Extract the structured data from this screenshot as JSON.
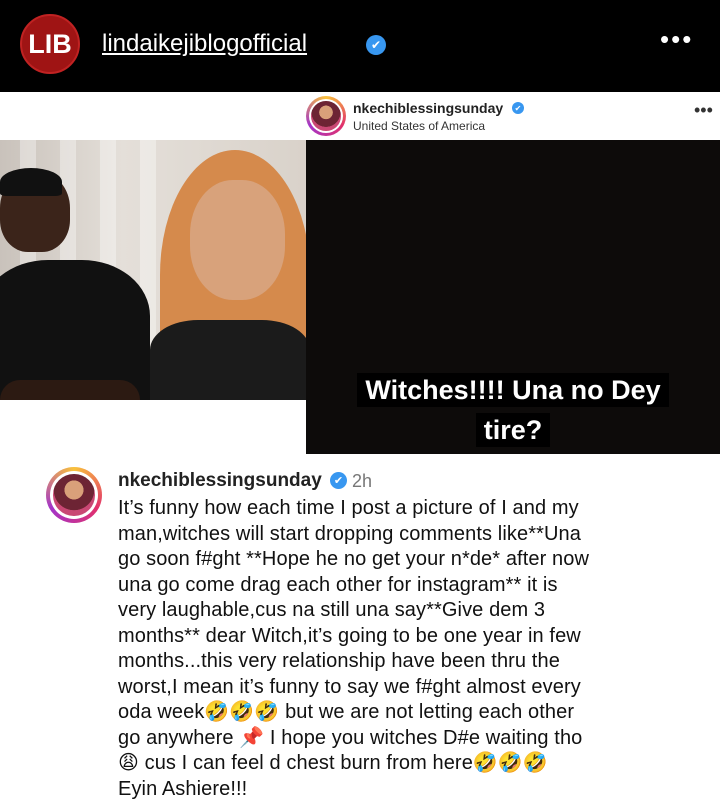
{
  "header": {
    "logo_text": "LIB",
    "username": "lindaikejiblogofficial",
    "verified_icon": "✔",
    "more_icon": "•••"
  },
  "story": {
    "username": "nkechiblessingsunday",
    "verified_icon": "✔",
    "location": "United States of America",
    "more_icon": "•••",
    "caption_line1": "Witches!!!! Una no Dey",
    "caption_line2": "tire?"
  },
  "comment": {
    "username": "nkechiblessingsunday",
    "verified_icon": "✔",
    "time": "2h",
    "lines": [
      "It’s funny how each time I post a picture of I and my",
      "man,witches will start dropping comments like**Una",
      "go soon f#ght **Hope he no get your n*de* after now",
      "una go come drag each other for instagram** it is",
      "very laughable,cus na still una say**Give dem 3",
      "months** dear Witch,it’s going to be one year in few",
      "months...this very relationship have been thru the",
      "worst,I mean it’s funny to say we f#ght almost every",
      "oda week🤣🤣🤣 but we are not letting each other",
      "go anywhere 📌 I hope you witches D#e waiting tho",
      "😩 cus I can feel d chest burn from here🤣🤣🤣",
      "Eyin Ashiere!!!"
    ]
  },
  "colors": {
    "header_bg": "#000000",
    "logo_red": "#9f1414",
    "verified_blue": "#3897f0",
    "story_bg": "#0d0b0a"
  }
}
